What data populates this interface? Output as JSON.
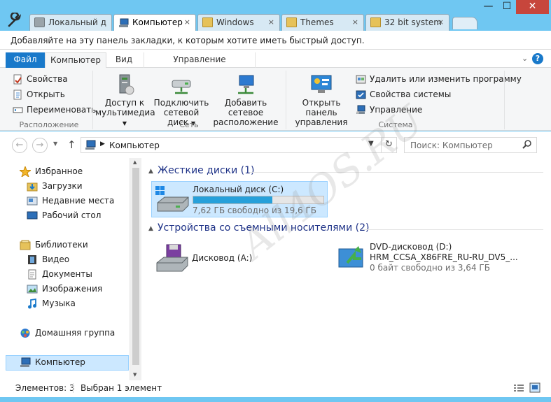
{
  "window": {
    "minimize_glyph": "—",
    "maximize_glyph": "☐",
    "close_glyph": "✕"
  },
  "tabs": [
    {
      "label": "Локальный д",
      "icon": "drive-icon",
      "active": false
    },
    {
      "label": "Компьютер",
      "icon": "computer-icon",
      "active": true,
      "close": "×"
    },
    {
      "label": "Windows",
      "icon": "folder-icon",
      "active": false,
      "close": "×"
    },
    {
      "label": "Themes",
      "icon": "folder-icon",
      "active": false,
      "close": "×"
    },
    {
      "label": "32 bit system",
      "icon": "folder-icon",
      "active": false,
      "close": "×"
    }
  ],
  "bookmarks_bar": {
    "text": "Добавляйте на эту панель закладки, к которым хотите иметь быстрый доступ."
  },
  "ribbon_tabs": {
    "file": "Файл",
    "computer": "Компьютер",
    "view": "Вид",
    "manage": "Управление"
  },
  "ribbon": {
    "location": {
      "label": "Расположение",
      "properties": "Свойства",
      "open": "Открыть",
      "rename": "Переименовать"
    },
    "network": {
      "label": "Сеть",
      "media_line1": "Доступ к",
      "media_line2": "мультимедиа",
      "map_line1": "Подключить",
      "map_line2": "сетевой диск",
      "add_line1": "Добавить сетевое",
      "add_line2": "расположение"
    },
    "system": {
      "label": "Система",
      "cp_line1": "Открыть панель",
      "cp_line2": "управления",
      "uninstall": "Удалить или изменить программу",
      "sysprops": "Свойства системы",
      "manage": "Управление"
    }
  },
  "address": {
    "path": "Компьютер",
    "search_placeholder": "Поиск: Компьютер"
  },
  "nav_pane": {
    "favorites": "Избранное",
    "downloads": "Загрузки",
    "recent": "Недавние места",
    "desktop": "Рабочий стол",
    "libraries": "Библиотеки",
    "video": "Видео",
    "documents": "Документы",
    "pictures": "Изображения",
    "music": "Музыка",
    "homegroup": "Домашняя группа",
    "computer": "Компьютер"
  },
  "content": {
    "hard_disks_header": "Жесткие диски (1)",
    "local_disk": {
      "name": "Локальный диск (C:)",
      "free": "7,62 ГБ свободно из 19,6 ГБ",
      "used_fraction": 0.61
    },
    "removable_header": "Устройства со съемными носителями (2)",
    "floppy": {
      "name": "Дисковод (A:)"
    },
    "dvd": {
      "name": "DVD-дисковод (D:)",
      "label": "HRM_CCSA_X86FRE_RU-RU_DV5_...",
      "free": "0 байт свободно из 3,64 ГБ"
    }
  },
  "status": {
    "items": "Элементов: 3",
    "selected": "Выбран 1 элемент"
  },
  "watermark": "All4OS.RU",
  "colors": {
    "frame": "#6fc7f2",
    "file_tab": "#1979ca",
    "selection": "#cce8ff",
    "progress": "#26a0da",
    "close_button": "#c7463c"
  }
}
